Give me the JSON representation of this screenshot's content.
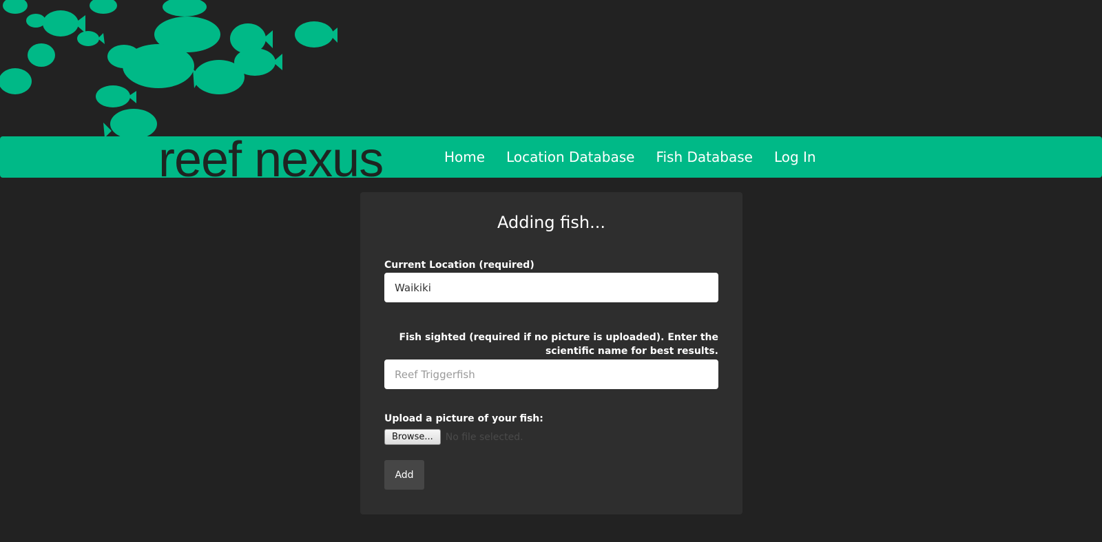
{
  "brand": {
    "name": "reef nexus"
  },
  "nav": {
    "items": [
      {
        "label": "Home"
      },
      {
        "label": "Location Database"
      },
      {
        "label": "Fish Database"
      },
      {
        "label": "Log In"
      }
    ]
  },
  "form": {
    "title": "Adding fish...",
    "location": {
      "label": "Current Location (required)",
      "value": "Waikiki"
    },
    "fish": {
      "label": "Fish sighted (required if no picture is uploaded). Enter the scientific name for best results.",
      "placeholder": "Reef Triggerfish"
    },
    "upload": {
      "label": "Upload a picture of your fish:",
      "browse_label": "Browse...",
      "status": "No file selected."
    },
    "submit_label": "Add"
  },
  "colors": {
    "accent": "#00b987",
    "background": "#222222",
    "card": "#2e2e2e"
  }
}
